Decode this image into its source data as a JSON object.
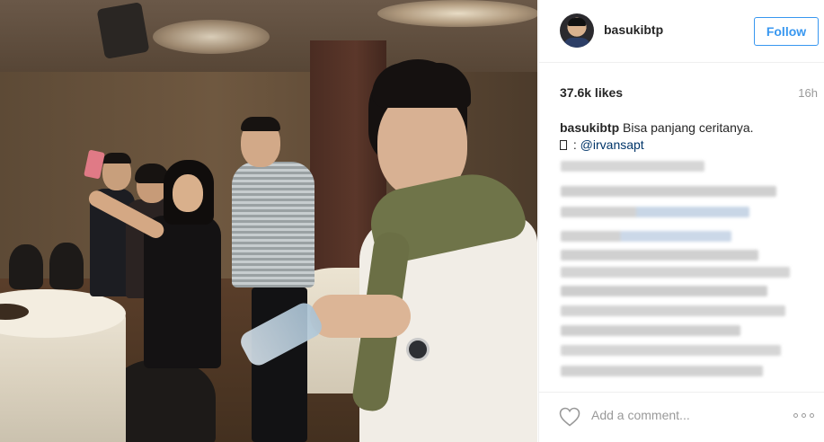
{
  "post": {
    "username": "basukibtp",
    "follow_label": "Follow",
    "likes": "37.6k likes",
    "time_ago": "16h",
    "caption_user": "basukibtp",
    "caption_text": "Bisa panjang ceritanya.",
    "caption_credit_prefix": " : ",
    "caption_mention": "@irvansapt",
    "comment_placeholder": "Add a comment...",
    "icons": [
      "heart-icon",
      "more-options-icon"
    ]
  },
  "colors": {
    "follow_blue": "#3897f0",
    "mention_blue": "#003569",
    "muted_gray": "#999999",
    "border_gray": "#efefef"
  }
}
